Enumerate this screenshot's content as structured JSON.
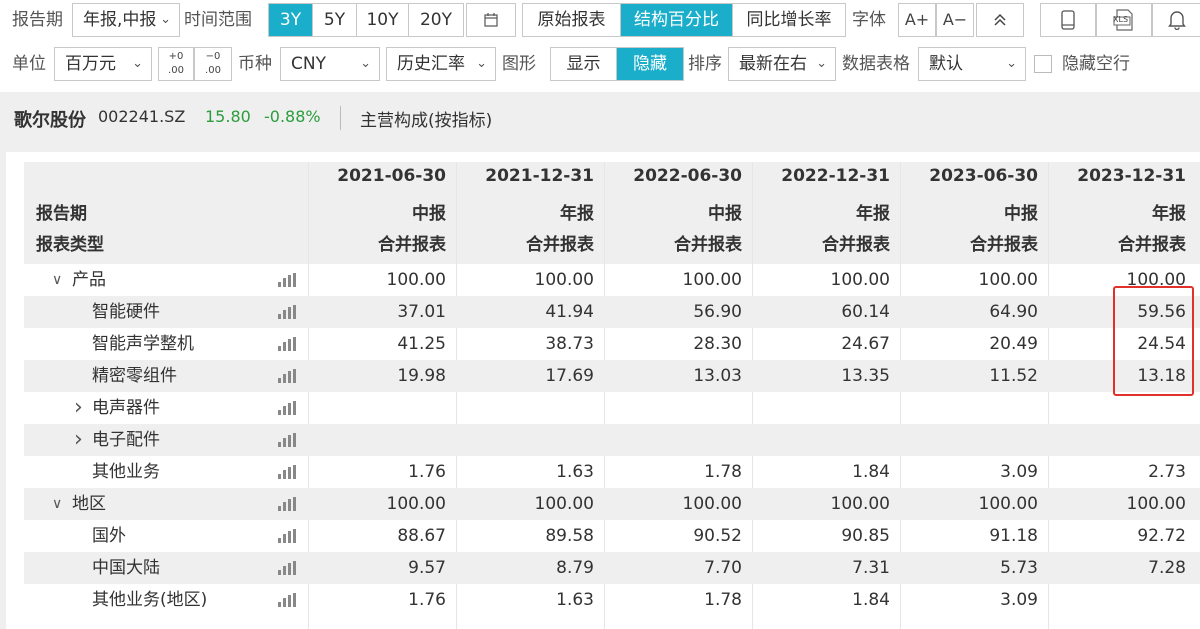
{
  "toolbar1": {
    "report_period_label": "报告期",
    "report_period_value": "年报,中报",
    "time_range_label": "时间范围",
    "time_ranges": [
      "3Y",
      "5Y",
      "10Y",
      "20Y"
    ],
    "active_time_range": "3Y",
    "view_modes": [
      "原始报表",
      "结构百分比",
      "同比增长率"
    ],
    "active_view_mode": "结构百分比",
    "font_label": "字体",
    "font_increase": "A+",
    "font_decrease": "A−",
    "collapse_icon": "double-chevron-up-icon",
    "phone_icon": "phone-icon",
    "excel_label": "XLS",
    "bell_icon": "bell-icon"
  },
  "toolbar2": {
    "unit_label": "单位",
    "unit_value": "百万元",
    "decimal_inc": "+0 .00",
    "decimal_dec": "-0 .00",
    "currency_label": "币种",
    "currency_value": "CNY",
    "fx_value": "历史汇率",
    "chart_label": "图形",
    "chart_show": "显示",
    "chart_hide": "隐藏",
    "chart_active": "隐藏",
    "sort_label": "排序",
    "sort_value": "最新在右",
    "table_label": "数据表格",
    "table_value": "默认",
    "hide_empty_label": "隐藏空行"
  },
  "stock": {
    "name": "歌尔股份",
    "code": "002241.SZ",
    "price": "15.80",
    "change": "-0.88%",
    "section_title": "主营构成(按指标)"
  },
  "table": {
    "row_header_period": "报告期",
    "row_header_type": "报表类型",
    "columns": [
      {
        "date": "2021-06-30",
        "period": "中报",
        "type": "合并报表"
      },
      {
        "date": "2021-12-31",
        "period": "年报",
        "type": "合并报表"
      },
      {
        "date": "2022-06-30",
        "period": "中报",
        "type": "合并报表"
      },
      {
        "date": "2022-12-31",
        "period": "年报",
        "type": "合并报表"
      },
      {
        "date": "2023-06-30",
        "period": "中报",
        "type": "合并报表"
      },
      {
        "date": "2023-12-31",
        "period": "年报",
        "type": "合并报表"
      }
    ],
    "rows": [
      {
        "label": "产品",
        "level": 0,
        "expander": "down",
        "values": [
          "100.00",
          "100.00",
          "100.00",
          "100.00",
          "100.00",
          "100.00"
        ]
      },
      {
        "label": "智能硬件",
        "level": 1,
        "expander": "",
        "values": [
          "37.01",
          "41.94",
          "56.90",
          "60.14",
          "64.90",
          "59.56"
        ]
      },
      {
        "label": "智能声学整机",
        "level": 1,
        "expander": "",
        "values": [
          "41.25",
          "38.73",
          "28.30",
          "24.67",
          "20.49",
          "24.54"
        ]
      },
      {
        "label": "精密零组件",
        "level": 1,
        "expander": "",
        "values": [
          "19.98",
          "17.69",
          "13.03",
          "13.35",
          "11.52",
          "13.18"
        ]
      },
      {
        "label": "电声器件",
        "level": 1,
        "expander": "right",
        "values": [
          "",
          "",
          "",
          "",
          "",
          ""
        ]
      },
      {
        "label": "电子配件",
        "level": 1,
        "expander": "right",
        "values": [
          "",
          "",
          "",
          "",
          "",
          ""
        ]
      },
      {
        "label": "其他业务",
        "level": 1,
        "expander": "",
        "values": [
          "1.76",
          "1.63",
          "1.78",
          "1.84",
          "3.09",
          "2.73"
        ]
      },
      {
        "label": "地区",
        "level": 0,
        "expander": "down",
        "values": [
          "100.00",
          "100.00",
          "100.00",
          "100.00",
          "100.00",
          "100.00"
        ]
      },
      {
        "label": "国外",
        "level": 1,
        "expander": "",
        "values": [
          "88.67",
          "89.58",
          "90.52",
          "90.85",
          "91.18",
          "92.72"
        ]
      },
      {
        "label": "中国大陆",
        "level": 1,
        "expander": "",
        "values": [
          "9.57",
          "8.79",
          "7.70",
          "7.31",
          "5.73",
          "7.28"
        ]
      },
      {
        "label": "其他业务(地区)",
        "level": 1,
        "expander": "",
        "values": [
          "1.76",
          "1.63",
          "1.78",
          "1.84",
          "3.09",
          ""
        ]
      }
    ]
  }
}
